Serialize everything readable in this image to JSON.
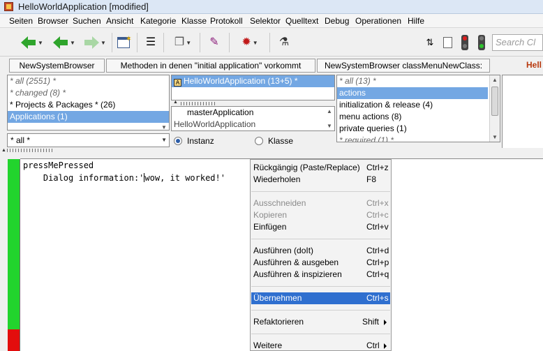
{
  "window": {
    "title": "HelloWorldApplication [modified]"
  },
  "menubar": [
    "Seiten",
    "Browser",
    "Suchen",
    "Ansicht",
    "Kategorie",
    "Klasse",
    "Protokoll",
    "Selektor",
    "Quelltext",
    "Debug",
    "Operationen",
    "Hilfe"
  ],
  "toolbar": {
    "search_placeholder": "Search Cl"
  },
  "tabs": [
    "NewSystemBrowser",
    "Methoden in denen \"initial application\" vorkommt",
    "NewSystemBrowser classMenuNewClass:"
  ],
  "tab_overflow": "Hell",
  "categories": [
    "* all (2551) *",
    "* changed (8) *",
    "* Projects & Packages * (26)",
    "Applications (1)"
  ],
  "category_filter": "* all *",
  "class_list_top": [
    "HelloWorldApplication (13+5)  *"
  ],
  "class_list_bottom": [
    "masterApplication",
    "HelloWorldApplication"
  ],
  "radio": {
    "instance": "Instanz",
    "class": "Klasse"
  },
  "protocols": [
    "* all (13) *",
    "actions",
    "initialization & release (4)",
    "menu actions (8)",
    "private queries (1)",
    "* required (1) *"
  ],
  "code": {
    "line1": "pressMePressed",
    "line2_prefix": "    Dialog information:'",
    "line2_rest": "wow, it worked!'"
  },
  "context_menu": {
    "undo": {
      "label": "Rückgängig (Paste/Replace)",
      "key": "Ctrl+z"
    },
    "redo": {
      "label": "Wiederholen",
      "key": "F8"
    },
    "cut": {
      "label": "Ausschneiden",
      "key": "Ctrl+x"
    },
    "copy": {
      "label": "Kopieren",
      "key": "Ctrl+c"
    },
    "paste": {
      "label": "Einfügen",
      "key": "Ctrl+v"
    },
    "doit": {
      "label": "Ausführen (doIt)",
      "key": "Ctrl+d"
    },
    "print": {
      "label": "Ausführen & ausgeben",
      "key": "Ctrl+p"
    },
    "inspect": {
      "label": "Ausführen & inspizieren",
      "key": "Ctrl+q"
    },
    "accept": {
      "label": "Übernehmen",
      "key": "Ctrl+s"
    },
    "refactor": {
      "label": "Refaktorieren",
      "key": "Shift"
    },
    "more": {
      "label": "Weitere",
      "key": "Ctrl"
    }
  },
  "colors": {
    "selection": "#73a7e3",
    "menu_selection": "#2f6fcf",
    "gutter_ok": "#22d42d",
    "gutter_err": "#e30d0d"
  }
}
